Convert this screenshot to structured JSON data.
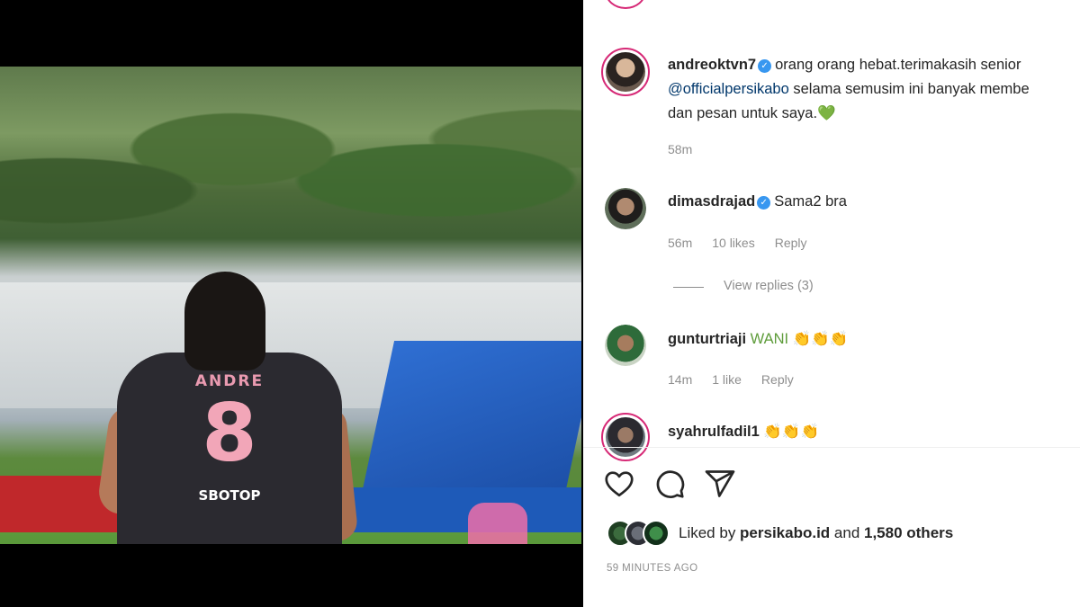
{
  "post": {
    "author": "andreoktvn7",
    "caption_line1": "orang orang hebat.terimakasih senior",
    "caption_mention": "@officialpersikabo",
    "caption_line2_rest": " selama semusim ini banyak membe",
    "caption_line3": "dan pesan untuk saya.💚",
    "age": "58m",
    "jersey": {
      "name": "ANDRE",
      "number": "8",
      "sponsor": "SBOTOP"
    }
  },
  "comments": [
    {
      "user": "dimasdrajad",
      "verified": true,
      "text": "Sama2 bra",
      "age": "56m",
      "likes": "10 likes",
      "reply": "Reply",
      "view_replies": "View replies (3)"
    },
    {
      "user": "gunturtriaji",
      "verified": false,
      "text": "WANI 👏👏👏",
      "age": "14m",
      "likes": "1 like",
      "reply": "Reply"
    },
    {
      "user": "syahrulfadil1",
      "verified": false,
      "text": "👏👏👏"
    }
  ],
  "actions": {
    "like_icon": "heart-icon",
    "comment_icon": "comment-icon",
    "share_icon": "send-icon"
  },
  "likes": {
    "prefix": "Liked by ",
    "user": "persikabo.id",
    "middle": " and ",
    "count": "1,580 others"
  },
  "timestamp": "59 MINUTES AGO",
  "colors": {
    "verified": "#3897f0",
    "story_ring": "#d62976",
    "meta": "#8e8e8e",
    "link": "#00376b"
  }
}
